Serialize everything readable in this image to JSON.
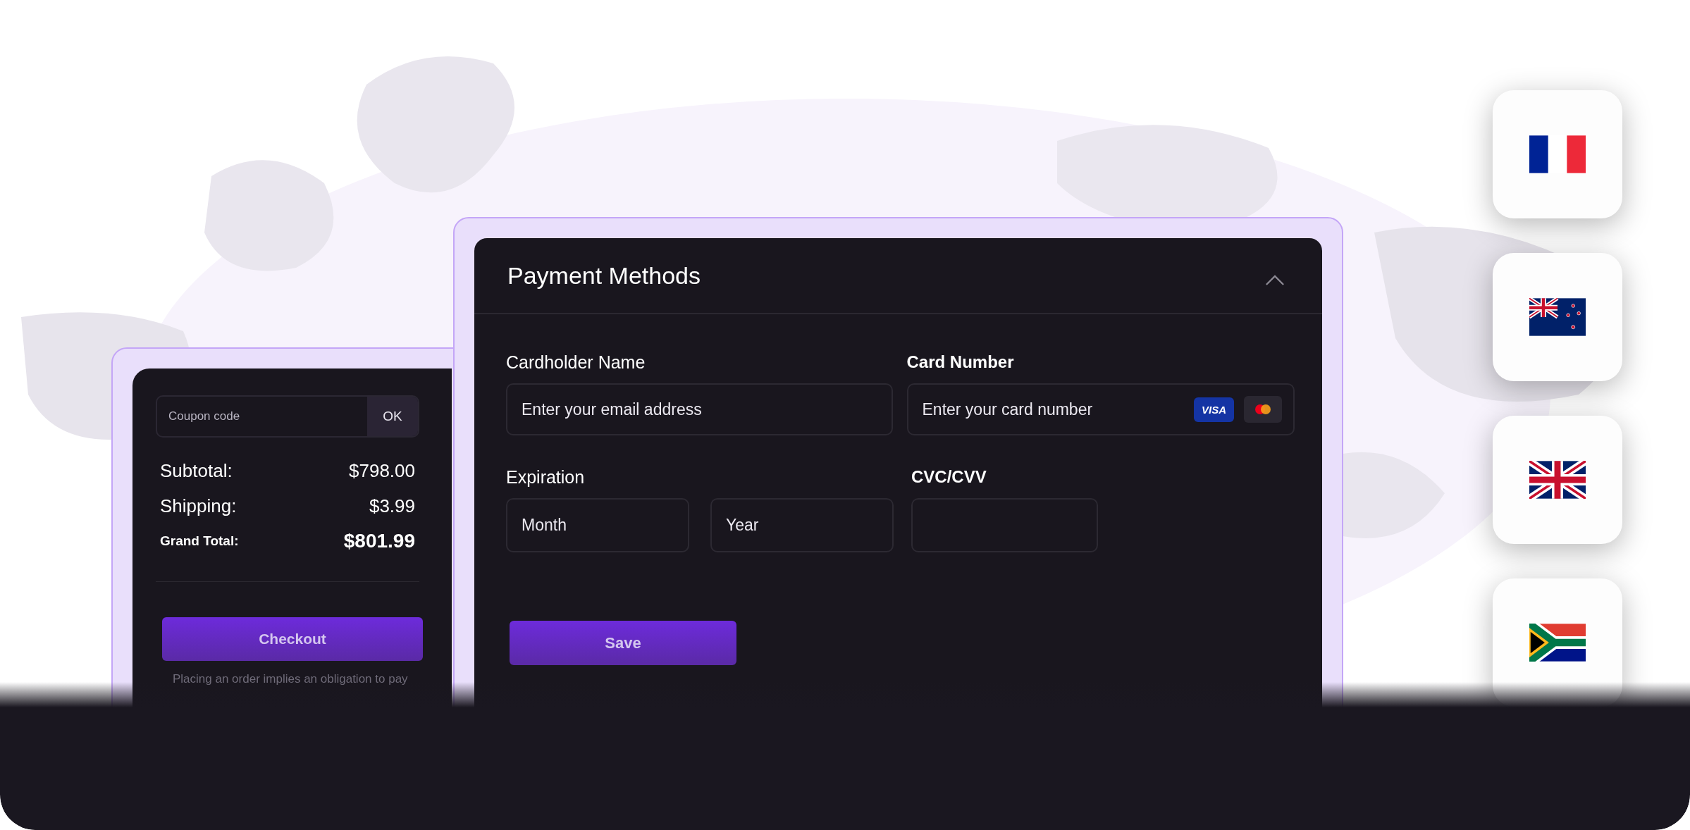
{
  "order_summary": {
    "coupon": {
      "placeholder": "Coupon code",
      "button": "OK"
    },
    "rows": [
      {
        "kind": "line",
        "label": "Subtotal:",
        "value": "$798.00"
      },
      {
        "kind": "line",
        "label": "Shipping:",
        "value": "$3.99"
      },
      {
        "kind": "total",
        "label": "Grand Total:",
        "value": "$801.99"
      }
    ],
    "checkout_button": "Checkout",
    "note": "Placing an order implies an obligation to pay"
  },
  "payment_methods": {
    "title": "Payment Methods",
    "expanded": true,
    "cardholder": {
      "label": "Cardholder Name",
      "placeholder": "Enter your email address"
    },
    "card_number": {
      "label": "Card Number",
      "placeholder": "Enter your card number",
      "visa_badge": "VISA"
    },
    "expiration": {
      "label": "Expiration",
      "month_placeholder": "Month",
      "year_placeholder": "Year"
    },
    "cvc": {
      "label": "CVC/CVV"
    },
    "save_button": "Save"
  },
  "flags": [
    {
      "kind": "france"
    },
    {
      "kind": "new_zealand"
    },
    {
      "kind": "united_kingdom"
    },
    {
      "kind": "south_africa"
    }
  ]
}
